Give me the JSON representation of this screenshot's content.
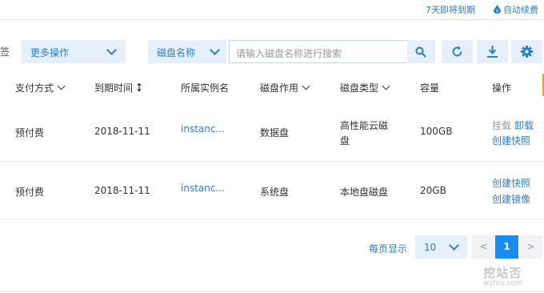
{
  "top": {
    "expiring": "7天即将到期",
    "auto_renew": "自动续费"
  },
  "toolbar": {
    "tag_fragment": "签",
    "more_actions": "更多操作",
    "search_field": "磁盘名称",
    "search_placeholder": "请输入磁盘名称进行搜索"
  },
  "table": {
    "headers": [
      "支付方式",
      "到期时间",
      "所属实例名",
      "磁盘作用",
      "磁盘类型",
      "容量",
      "操作"
    ],
    "rows": [
      {
        "pay": "预付费",
        "expire": "2018-11-11",
        "instance": "instanc...",
        "role": "数据盘",
        "type_line1": "高性能云磁",
        "type_line2": "盘",
        "capacity": "100GB",
        "op_mount": "挂载",
        "op_unmount": "卸载",
        "op_snapshot": "创建快照"
      },
      {
        "pay": "预付费",
        "expire": "2018-11-11",
        "instance": "instanc...",
        "role": "系统盘",
        "type": "本地盘磁盘",
        "capacity": "20GB",
        "op_snapshot": "创建快照",
        "op_image": "创建镜像"
      }
    ]
  },
  "pagination": {
    "per_page_label": "每页显示",
    "per_page": "10",
    "prev": "<",
    "current": "1",
    "next": ">"
  },
  "watermark": {
    "line1": "挖站否",
    "line2": "wzfou.com"
  },
  "colors": {
    "accent": "#2a7ecb",
    "page_active": "#1a8cf0",
    "select_bg": "#e6f0fa"
  }
}
